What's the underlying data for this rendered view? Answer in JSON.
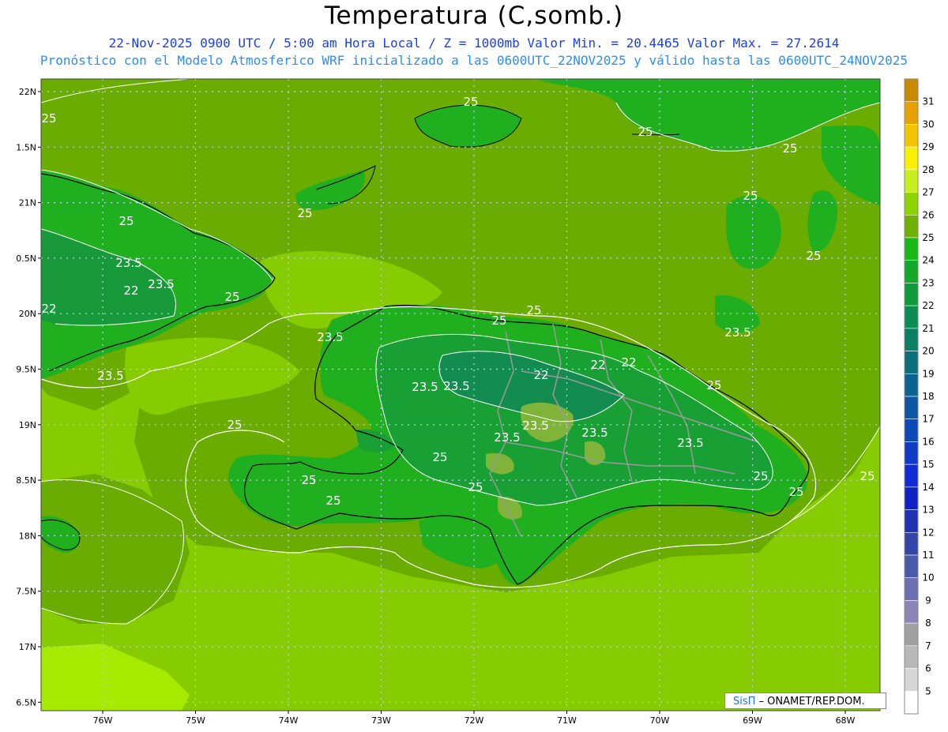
{
  "title": "Temperatura (C,somb.)",
  "subtitle_line1": "22-Nov-2025  0900 UTC / 5:00 am Hora Local / Z = 1000mb   Valor Min. = 20.4465  Valor Max. = 27.2614",
  "subtitle_line2": "Pronóstico con el Modelo Atmosferico WRF inicializado a las 0600UTC_22NOV2025 y válido hasta las  0600UTC_24NOV2025",
  "credit": {
    "sis": "SisΠ",
    "rest": " – ONAMET/REP.DOM."
  },
  "y_ticks": [
    "22N",
    "1.5N",
    "21N",
    "0.5N",
    "20N",
    "9.5N",
    "19N",
    "8.5N",
    "18N",
    "7.5N",
    "17N",
    "6.5N"
  ],
  "x_ticks": [
    "76W",
    "75W",
    "74W",
    "73W",
    "72W",
    "71W",
    "70W",
    "69W",
    "68W"
  ],
  "colorbar": {
    "labels": [
      "31",
      "30",
      "29",
      "28",
      "27",
      "26",
      "25",
      "24",
      "23",
      "22",
      "21",
      "20",
      "19",
      "18",
      "17",
      "16",
      "15",
      "14",
      "13",
      "12",
      "11",
      "10",
      "9",
      "8",
      "7",
      "6",
      "5"
    ],
    "colors": [
      "#c98a00",
      "#e6a000",
      "#f5c400",
      "#f7f000",
      "#c8f020",
      "#8ed400",
      "#6fb000",
      "#18b818",
      "#12a82a",
      "#0e9a3c",
      "#0c8c50",
      "#0b7e66",
      "#0b707c",
      "#0c6290",
      "#0d56a4",
      "#0e48b6",
      "#0f3ac6",
      "#0f2cd4",
      "#1020c2",
      "#2032b0",
      "#3444a8",
      "#4a5aa8",
      "#6a70b2",
      "#8c86b8",
      "#a0a0a0",
      "#b8b8b8",
      "#d6d6d6",
      "#ffffff"
    ]
  },
  "contour_labels": [
    "25",
    "25",
    "25",
    "25",
    "25",
    "25",
    "25",
    "25",
    "23.5",
    "23.5",
    "22",
    "22",
    "25",
    "25",
    "25",
    "23.5",
    "23.5",
    "22",
    "22",
    "22",
    "23.5",
    "23.5",
    "25",
    "23.5",
    "23.5",
    "23.5",
    "23.5",
    "23.5",
    "25",
    "25",
    "25",
    "25",
    "25",
    "25",
    "25",
    "25"
  ],
  "colors": {
    "sea_light": "#8ccf00",
    "land_mid": "#6fb000",
    "land_dark": "#1fad24",
    "hot_lowlat": "#a3e800"
  }
}
